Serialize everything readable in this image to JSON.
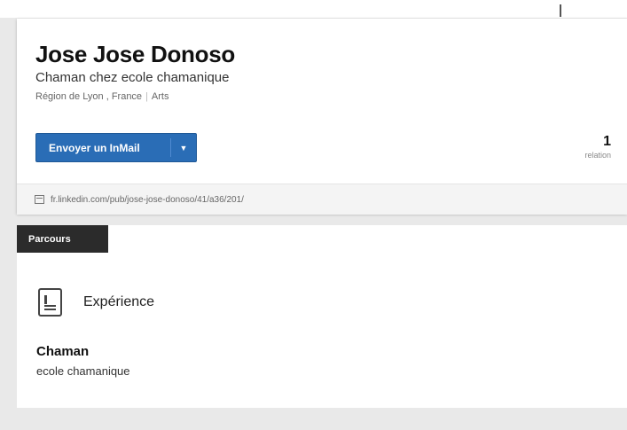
{
  "profile": {
    "name": "Jose Jose Donoso",
    "headline": "Chaman chez ecole chamanique",
    "location": "Région de Lyon , France",
    "industry": "Arts",
    "inmail_button": "Envoyer un InMail",
    "relations_count": "1",
    "relations_label": "relation",
    "public_url": "fr.linkedin.com/pub/jose-jose-donoso/41/a36/201/"
  },
  "tabs": {
    "parcours": "Parcours"
  },
  "experience": {
    "section_title": "Expérience",
    "icon": "document-icon",
    "items": [
      {
        "title": "Chaman",
        "company": "ecole chamanique"
      }
    ]
  },
  "colors": {
    "button_blue": "#2a6db6",
    "tab_dark": "#2b2b2b",
    "page_gray": "#e9e9e9"
  }
}
